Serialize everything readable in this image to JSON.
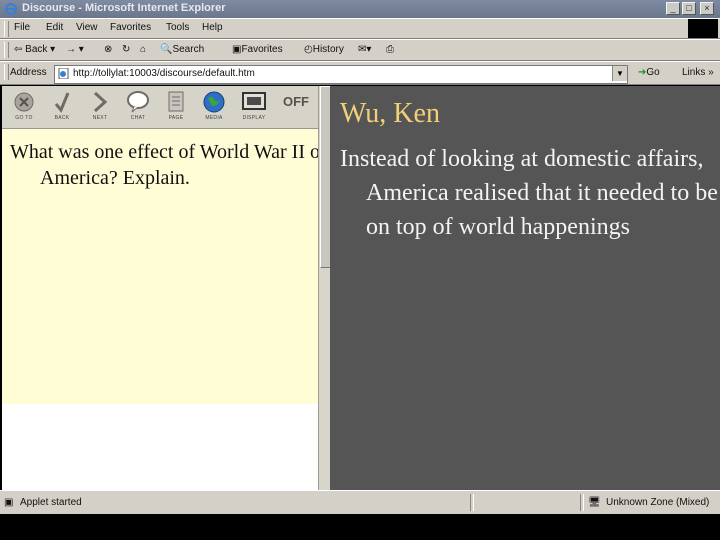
{
  "window": {
    "title": "Discourse - Microsoft Internet Explorer",
    "controls": [
      "_",
      "□",
      "×"
    ]
  },
  "menubar": {
    "items": [
      "File",
      "Edit",
      "View",
      "Favorites",
      "Tools",
      "Help"
    ]
  },
  "toolbar": {
    "back": "Back",
    "forward": "→",
    "search": "Search",
    "favorites": "Favorites",
    "history": "History"
  },
  "addressbar": {
    "label": "Address",
    "url": "http://tollylat:10003/discourse/default.htm",
    "go": "Go",
    "links": "Links »"
  },
  "app_toolbar": {
    "buttons": [
      {
        "label": "GO TO",
        "icon": "goto-icon"
      },
      {
        "label": "BACK",
        "icon": "back-check-icon"
      },
      {
        "label": "NEXT",
        "icon": "next-arrow-icon"
      },
      {
        "label": "CHAT",
        "icon": "chat-bubble-icon"
      },
      {
        "label": "PAGE",
        "icon": "page-icon"
      },
      {
        "label": "MEDIA",
        "icon": "globe-icon"
      },
      {
        "label": "DISPLAY",
        "icon": "display-icon"
      },
      {
        "label": "OFF",
        "icon": "off-icon"
      }
    ]
  },
  "question": "What was one effect of World War II on America? Explain.",
  "response": {
    "author": "Wu, Ken",
    "text": "Instead of looking at domestic affairs, America realised that it needed to be on top of world happenings"
  },
  "statusbar": {
    "left": "Applet started",
    "right": "Unknown Zone (Mixed)"
  },
  "colors": {
    "question_bg": "#fffdd6",
    "response_bg": "#555555",
    "author_color": "#f1d077"
  }
}
